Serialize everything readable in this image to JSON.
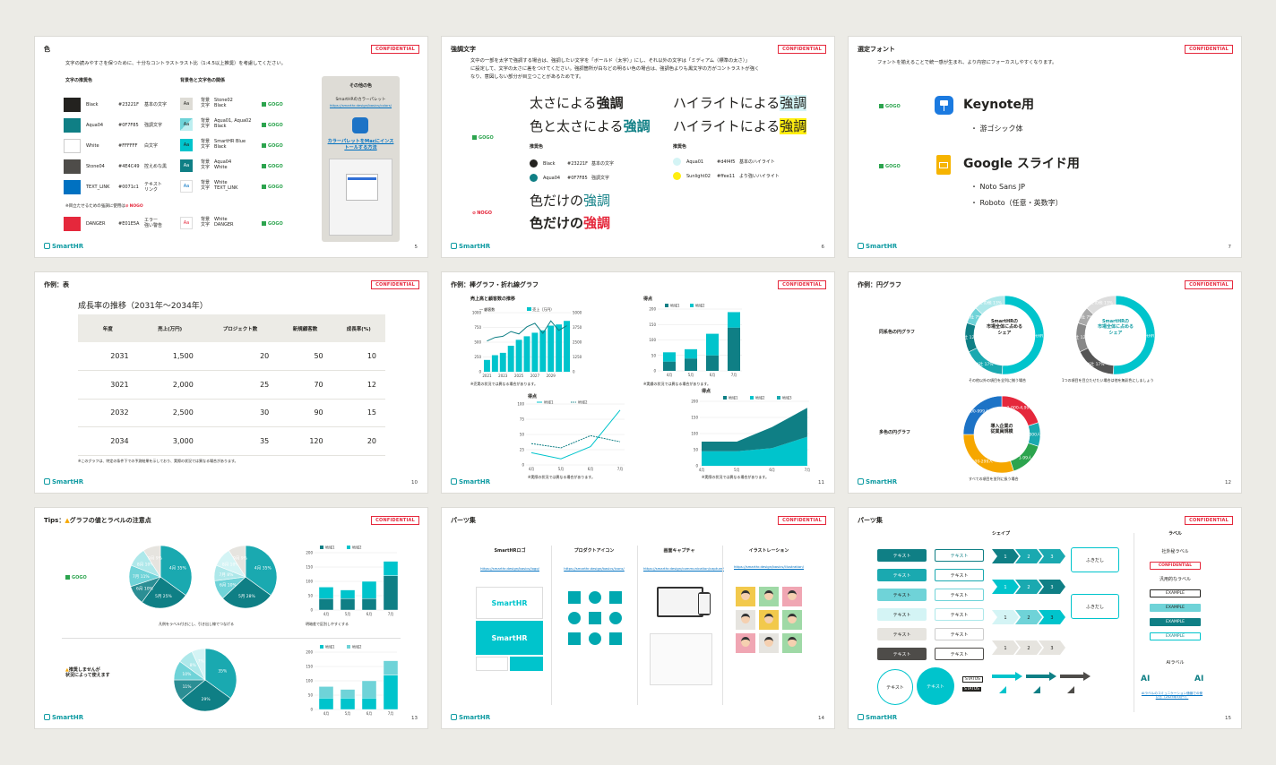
{
  "s1": {
    "title": "色",
    "conf": "CONFIDENTIAL",
    "logo": "SmartHR",
    "page": "5",
    "desc": "文字の読みやすさを保つために、十分なコントラストラスト比（1:4.5以上推奨）を考慮してください。",
    "h_text": "文字の推奨色",
    "h_bg": "背景色と文字色の関係",
    "colors": [
      {
        "name": "Black",
        "hex": "#23221F",
        "use": "基本の文字",
        "c": "#23221f"
      },
      {
        "name": "Aqua04",
        "hex": "#0F7F85",
        "use": "強調文字",
        "c": "#0f7f85"
      },
      {
        "name": "White",
        "hex": "#FFFFFF",
        "use": "白文字",
        "c": "#ffffff"
      },
      {
        "name": "Stone04",
        "hex": "#4E4C49",
        "use": "控えめな黒",
        "c": "#4e4c49"
      },
      {
        "name": "TEXT_LINK",
        "hex": "#0071c1",
        "use": "テキストリンク",
        "c": "#0071c1"
      }
    ],
    "note": "※目立たせるための強調に使用は",
    "nogo": "NOGO",
    "danger": {
      "name": "DANGER",
      "hex": "#E01E5A",
      "use": "エラー\n強い警告",
      "c": "#e5283c"
    },
    "pairs": [
      {
        "bgk": "背景",
        "bg": "Stone02",
        "fgk": "文字",
        "fg": "Black",
        "go": "GOGO"
      },
      {
        "bgk": "背景",
        "bg": "Aqua01, Aqua02",
        "fgk": "文字",
        "fg": "Black",
        "go": "GOGO"
      },
      {
        "bgk": "背景",
        "bg": "SmartHR Blue",
        "fgk": "文字",
        "fg": "Black",
        "go": "GOGO"
      },
      {
        "bgk": "背景",
        "bg": "Aqua04",
        "fgk": "文字",
        "fg": "White",
        "go": "GOGO"
      },
      {
        "bgk": "背景",
        "bg": "White",
        "fgk": "文字",
        "fg": "TEXT_LINK",
        "go": "GOGO"
      },
      {
        "bgk": "背景",
        "bg": "White",
        "fgk": "文字",
        "fg": "DANGER",
        "go": "GOGO"
      }
    ],
    "aa": "Aa",
    "side_title": "その他の色",
    "side_sub": "SmartHRのカラーパレット",
    "side_link": "https://smarthr.design/basics/colors/",
    "side_cta": "カラーパレットをMacにインストールする方法"
  },
  "s2": {
    "title": "強調文字",
    "conf": "CONFIDENTIAL",
    "logo": "SmartHR",
    "page": "6",
    "desc1": "文中の一部を太字で強調する場合は、強調したい文字を「ボールド（太字）」にし、それ以外の文字は「ミディアム（標準の太さ）」",
    "desc2": "に設定して、文字の太さに差をつけてください。強調箇所が白などの明るい色の場合は、強調色よりも黒文字の方がコントラストが強く",
    "desc3": "なり、意図しない部分が目立つことがあるためです。",
    "a1": "太さによる",
    "a1b": "強調",
    "a2": "色と太さによる",
    "a2b": "強調",
    "b1": "ハイライトによる",
    "b1b": "強調",
    "b2": "ハイライトによる",
    "b2b": "強調",
    "rec": "推奨色",
    "rec2": "推奨色",
    "r1": {
      "n": "Black",
      "h": "#23221F",
      "u": "基本の文字"
    },
    "r2": {
      "n": "Aqua04",
      "h": "#0F7F85",
      "u": "強調文字"
    },
    "r3": {
      "n": "Aqua01",
      "h": "#d4f4f5",
      "u": "基本のハイライト"
    },
    "r4": {
      "n": "Sunlight02",
      "h": "#ffee11",
      "u": "より強いハイライト"
    },
    "go": "GOGO",
    "ng": "NOGO",
    "c1": "色だけの",
    "c1b": "強調",
    "c2": "色だけの",
    "c2b": "強調"
  },
  "s3": {
    "title": "選定フォント",
    "conf": "CONFIDENTIAL",
    "logo": "SmartHR",
    "page": "7",
    "desc": "フォントを揃えることで統一感が生まれ、より内容にフォーカスしやすくなります。",
    "go1": "GOGO",
    "go2": "GOGO",
    "k": "Keynote用",
    "k1": "・ 游ゴシック体",
    "g": "Google スライド用",
    "g1": "・ Noto Sans JP",
    "g2": "・ Roboto（任意・英数字）"
  },
  "s4": {
    "title": "作例：表",
    "conf": "CONFIDENTIAL",
    "logo": "SmartHR",
    "page": "10",
    "caption": "成長率の推移（2031年〜2034年）",
    "headers": [
      "年度",
      "売上(万円)",
      "プロジェクト数",
      "新規顧客数",
      "成長率(%)"
    ],
    "rows": [
      [
        "2031",
        "1,500",
        "20",
        "50",
        "10"
      ],
      [
        "3021",
        "2,000",
        "25",
        "70",
        "12"
      ],
      [
        "2032",
        "2,500",
        "30",
        "90",
        "15"
      ],
      [
        "2034",
        "3,000",
        "35",
        "120",
        "20"
      ]
    ],
    "note": "※このグラフは、特定の条件下での予測結果を示しており、実際の状況では異なる場合があります。"
  },
  "s5": {
    "title": "作例：棒グラフ・折れ線グラフ",
    "conf": "CONFIDENTIAL",
    "logo": "SmartHR",
    "page": "11",
    "c1": "売上高と顧客数の推移",
    "c1l": [
      "顧客数",
      "売上（万円）"
    ],
    "c1note": "※売実の状況では異なる場合があります。",
    "c2": "得点",
    "c3": "得点",
    "c4": "得点",
    "leg": [
      "地域1",
      "地域2"
    ],
    "leg4": [
      "地域1",
      "地域2",
      "地域3"
    ],
    "note2": "※実績の状況では異なる場合があります。",
    "note3": "※実際の状況では異なる場合があります。",
    "note4": "※実際の状況では異なる場合があります。"
  },
  "s6": {
    "title": "作例：円グラフ",
    "conf": "CONFIDENTIAL",
    "logo": "SmartHR",
    "page": "12",
    "l1": "同系色の円グラフ",
    "l2": "多色の円グラフ",
    "d1": "SmartHRの\n市場全体に占める\nシェア",
    "d2": "SmartHRの\n市場全体に占める\nシェア",
    "d3": "導入企業の\n従業員規模",
    "n1": "その他以外の項目を全列に揃う場合",
    "n2": "1つの項目を目立たせたい場合は他を無彩色にしましょう",
    "n3": "すべての項目を並列に扱う場合"
  },
  "s7": {
    "title": "Tips：",
    "title2": "グラフの値とラベルの注意点",
    "conf": "CONFIDENTIAL",
    "logo": "SmartHR",
    "page": "13",
    "go": "GOGO",
    "warn1": "推奨しませんが",
    "warn2": "状況によって使えます",
    "n1": "凡例をラベル付きにし、引き出し線でつなげる",
    "n2": "明暗差で区別しやすくする",
    "leg": [
      "地域1",
      "地域2"
    ],
    "months": [
      "4月",
      "5月",
      "6月",
      "7月"
    ]
  },
  "s8": {
    "title": "パーツ集",
    "conf": "CONFIDENTIAL",
    "logo": "SmartHR",
    "page": "14",
    "cols": [
      {
        "h": "SmartHRロゴ",
        "u": "https://smarthr.design/basics/logo/"
      },
      {
        "h": "プロダクトアイコン",
        "u": "https://smarthr.design/basics/icons/"
      },
      {
        "h": "画面キャプチャ",
        "u": "https://smarthr.design/communication/capture/"
      },
      {
        "h": "イラストレーション",
        "u": "https://smarthr.design/basics/illustration/"
      }
    ],
    "logo_text": "SmartHR"
  },
  "s9": {
    "title": "パーツ集",
    "conf": "CONFIDENTIAL",
    "logo": "SmartHR",
    "page": "15",
    "shape": "シェイプ",
    "label": "ラベル",
    "text": "テキスト",
    "fuki": "ふきだし",
    "steps": [
      "1",
      "2",
      "3"
    ],
    "status": "STATUS",
    "inner": "社外秘ラベル",
    "general": "汎用的なラベル",
    "example": "EXAMPLE",
    "ai": "AIラベル",
    "ai_txt": "AI",
    "ai_link": "AIラベルのコミュニケーション価値での使い方（2025年5月〜）"
  }
}
